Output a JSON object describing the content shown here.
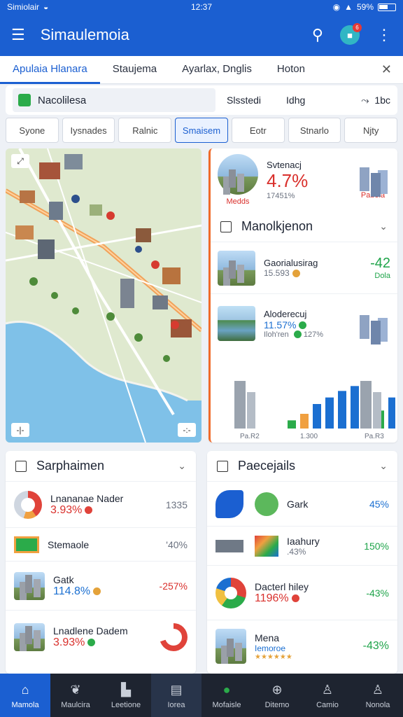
{
  "status": {
    "left_text": "Simiolair",
    "time": "12:37",
    "battery": "59%"
  },
  "appbar": {
    "title": "Simaulemoia",
    "notification_count": "6"
  },
  "tabs": [
    {
      "label": "Apulaia  Hlanara"
    },
    {
      "label": "Staujema"
    },
    {
      "label": "Ayarlax, Dnglis"
    },
    {
      "label": "Hoton"
    }
  ],
  "search": {
    "field_value": "Nacolilesa",
    "col2": "Slsstedi",
    "col3": "Idhg",
    "col4": "1bc"
  },
  "chips": [
    {
      "label": "Syone"
    },
    {
      "label": "Iysnades"
    },
    {
      "label": "Ralnic"
    },
    {
      "label": "Smaisem"
    },
    {
      "label": "Eotr"
    },
    {
      "label": "Stnarlo"
    },
    {
      "label": "Njty"
    }
  ],
  "map": {
    "ctl_bl": "-|-",
    "ctl_br": "-:-"
  },
  "panel_top": {
    "stat_title": "Svtenacj",
    "stat_pct": "4.7%",
    "stat_sub": "17451%",
    "left_label": "Medds",
    "right_label": "Pabeia"
  },
  "manolkjenon": {
    "header": "Manolkjenon",
    "rows": [
      {
        "title": "Gaorialusirag",
        "sub": "15.593",
        "value": "-42",
        "value_sub": "Dola"
      },
      {
        "title": "Aloderecuj",
        "sub": "11.57%",
        "sub2": "Iloh'ren",
        "sub3": "127%"
      }
    ]
  },
  "chart_data": {
    "type": "bar",
    "categories": [
      "Pa.R2",
      "1.300",
      "Pa.R3"
    ],
    "series": [
      {
        "values": [
          0,
          10,
          18,
          30,
          38,
          46,
          52,
          0,
          22,
          38
        ]
      }
    ],
    "xlabel": "",
    "ylabel": "",
    "title": ""
  },
  "chart_labels": [
    "Pa.R2",
    "1.300",
    "Pa.R3"
  ],
  "sarphaimen": {
    "header": "Sarphaimen",
    "rows": [
      {
        "title": "Lnananae Nader",
        "pct": "3.93%",
        "val": "1335"
      },
      {
        "title": "Stemaole",
        "pct": "",
        "val": "'40%"
      },
      {
        "title": "Gatk",
        "pct": "114.8%",
        "val": "-257%"
      },
      {
        "title": "Lnadlene Dadem",
        "pct": "3.93%",
        "val": ""
      }
    ]
  },
  "paecejails": {
    "header": "Paecejails",
    "rows": [
      {
        "title": "Gark",
        "pct": "",
        "val": "45%"
      },
      {
        "title": "Iaahury",
        "pct": ".43%",
        "val": "150%"
      },
      {
        "title": "Dacterl hiley",
        "pct": "1196%",
        "val": "-43%"
      },
      {
        "title": "Mena",
        "pct": "Iemoroe",
        "val": "-43%"
      }
    ]
  },
  "bottom_nav": [
    {
      "label": "Mamola",
      "icon": "home-icon"
    },
    {
      "label": "Maulcira",
      "icon": "leaf-icon"
    },
    {
      "label": "Leetione",
      "icon": "building-icon"
    },
    {
      "label": "Iorea",
      "icon": "card-icon"
    },
    {
      "label": "Mofaisle",
      "icon": "globe-icon"
    },
    {
      "label": "Ditemo",
      "icon": "search-plus-icon"
    },
    {
      "label": "Camio",
      "icon": "user-icon"
    },
    {
      "label": "Nonola",
      "icon": "user2-icon"
    }
  ],
  "colors": {
    "primary": "#1b5fd1",
    "red": "#d9302c",
    "green": "#1fa44a"
  }
}
